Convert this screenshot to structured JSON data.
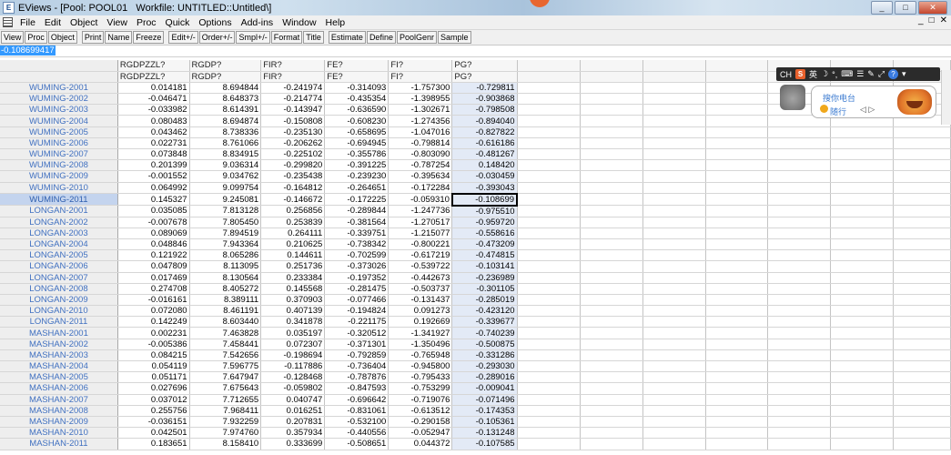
{
  "window": {
    "title": "EViews - [Pool: POOL01   Workfile: UNTITLED::Untitled\\]",
    "app_icon": "eviews-icon",
    "controls": [
      "_",
      "□",
      "✕"
    ]
  },
  "menu": {
    "items": [
      "File",
      "Edit",
      "Object",
      "View",
      "Proc",
      "Quick",
      "Options",
      "Add-ins",
      "Window",
      "Help"
    ],
    "doc_controls": [
      "_",
      "□",
      "✕"
    ]
  },
  "toolbar": {
    "groups": [
      [
        "View",
        "Proc",
        "Object"
      ],
      [
        "Print",
        "Name",
        "Freeze"
      ],
      [
        "Edit+/-",
        "Order+/-",
        "Smpl+/-",
        "Format",
        "Title"
      ],
      [
        "Estimate",
        "Define",
        "PoolGenr",
        "Sample"
      ]
    ]
  },
  "edit_line": {
    "value": "-0.108699417"
  },
  "grid": {
    "columns": [
      "RGDPZZL?",
      "RGDP?",
      "FIR?",
      "FE?",
      "FI?",
      "PG?"
    ],
    "subheaders": [
      "RGDPZZL?",
      "RGDP?",
      "FIR?",
      "FE?",
      "FI?",
      "PG?"
    ],
    "rows": [
      {
        "label": "WUMING-2001",
        "values": [
          "0.014181",
          "8.694844",
          "-0.241974",
          "-0.314093",
          "-1.757300",
          "-0.729811"
        ]
      },
      {
        "label": "WUMING-2002",
        "values": [
          "-0.046471",
          "8.648373",
          "-0.214774",
          "-0.435354",
          "-1.398955",
          "-0.903868"
        ]
      },
      {
        "label": "WUMING-2003",
        "values": [
          "-0.033982",
          "8.614391",
          "-0.143947",
          "-0.636590",
          "-1.302671",
          "-0.798508"
        ]
      },
      {
        "label": "WUMING-2004",
        "values": [
          "0.080483",
          "8.694874",
          "-0.150808",
          "-0.608230",
          "-1.274356",
          "-0.894040"
        ]
      },
      {
        "label": "WUMING-2005",
        "values": [
          "0.043462",
          "8.738336",
          "-0.235130",
          "-0.658695",
          "-1.047016",
          "-0.827822"
        ]
      },
      {
        "label": "WUMING-2006",
        "values": [
          "0.022731",
          "8.761066",
          "-0.206262",
          "-0.694945",
          "-0.798814",
          "-0.616186"
        ]
      },
      {
        "label": "WUMING-2007",
        "values": [
          "0.073848",
          "8.834915",
          "-0.225102",
          "-0.355786",
          "-0.803090",
          "-0.481267"
        ]
      },
      {
        "label": "WUMING-2008",
        "values": [
          "0.201399",
          "9.036314",
          "-0.299820",
          "-0.391225",
          "-0.787254",
          "0.148420"
        ]
      },
      {
        "label": "WUMING-2009",
        "values": [
          "-0.001552",
          "9.034762",
          "-0.235438",
          "-0.239230",
          "-0.395634",
          "-0.030459"
        ]
      },
      {
        "label": "WUMING-2010",
        "values": [
          "0.064992",
          "9.099754",
          "-0.164812",
          "-0.264651",
          "-0.172284",
          "-0.393043"
        ]
      },
      {
        "label": "WUMING-2011",
        "values": [
          "0.145327",
          "9.245081",
          "-0.146672",
          "-0.172225",
          "-0.059310",
          "-0.108699"
        ]
      },
      {
        "label": "LONGAN-2001",
        "values": [
          "0.035085",
          "7.813128",
          "0.256856",
          "-0.289844",
          "-1.247736",
          "-0.975510"
        ]
      },
      {
        "label": "LONGAN-2002",
        "values": [
          "-0.007678",
          "7.805450",
          "0.253839",
          "-0.381564",
          "-1.270517",
          "-0.959720"
        ]
      },
      {
        "label": "LONGAN-2003",
        "values": [
          "0.089069",
          "7.894519",
          "0.264111",
          "-0.339751",
          "-1.215077",
          "-0.558616"
        ]
      },
      {
        "label": "LONGAN-2004",
        "values": [
          "0.048846",
          "7.943364",
          "0.210625",
          "-0.738342",
          "-0.800221",
          "-0.473209"
        ]
      },
      {
        "label": "LONGAN-2005",
        "values": [
          "0.121922",
          "8.065286",
          "0.144611",
          "-0.702599",
          "-0.617219",
          "-0.474815"
        ]
      },
      {
        "label": "LONGAN-2006",
        "values": [
          "0.047809",
          "8.113095",
          "0.251736",
          "-0.373026",
          "-0.539722",
          "-0.103141"
        ]
      },
      {
        "label": "LONGAN-2007",
        "values": [
          "0.017469",
          "8.130564",
          "0.233384",
          "-0.197352",
          "-0.442673",
          "-0.236989"
        ]
      },
      {
        "label": "LONGAN-2008",
        "values": [
          "0.274708",
          "8.405272",
          "0.145568",
          "-0.281475",
          "-0.503737",
          "-0.301105"
        ]
      },
      {
        "label": "LONGAN-2009",
        "values": [
          "-0.016161",
          "8.389111",
          "0.370903",
          "-0.077466",
          "-0.131437",
          "-0.285019"
        ]
      },
      {
        "label": "LONGAN-2010",
        "values": [
          "0.072080",
          "8.461191",
          "0.407139",
          "-0.194824",
          "0.091273",
          "-0.423120"
        ]
      },
      {
        "label": "LONGAN-2011",
        "values": [
          "0.142249",
          "8.603440",
          "0.341878",
          "-0.221175",
          "0.192669",
          "-0.339677"
        ]
      },
      {
        "label": "MASHAN-2001",
        "values": [
          "0.002231",
          "7.463828",
          "0.035197",
          "-0.320512",
          "-1.341927",
          "-0.740239"
        ]
      },
      {
        "label": "MASHAN-2002",
        "values": [
          "-0.005386",
          "7.458441",
          "0.072307",
          "-0.371301",
          "-1.350496",
          "-0.500875"
        ]
      },
      {
        "label": "MASHAN-2003",
        "values": [
          "0.084215",
          "7.542656",
          "-0.198694",
          "-0.792859",
          "-0.765948",
          "-0.331286"
        ]
      },
      {
        "label": "MASHAN-2004",
        "values": [
          "0.054119",
          "7.596775",
          "-0.117886",
          "-0.736404",
          "-0.945800",
          "-0.293030"
        ]
      },
      {
        "label": "MASHAN-2005",
        "values": [
          "0.051171",
          "7.647947",
          "-0.128468",
          "-0.787876",
          "-0.795433",
          "-0.289016"
        ]
      },
      {
        "label": "MASHAN-2006",
        "values": [
          "0.027696",
          "7.675643",
          "-0.059802",
          "-0.847593",
          "-0.753299",
          "-0.009041"
        ]
      },
      {
        "label": "MASHAN-2007",
        "values": [
          "0.037012",
          "7.712655",
          "0.040747",
          "-0.696642",
          "-0.719076",
          "-0.071496"
        ]
      },
      {
        "label": "MASHAN-2008",
        "values": [
          "0.255756",
          "7.968411",
          "0.016251",
          "-0.831061",
          "-0.613512",
          "-0.174353"
        ]
      },
      {
        "label": "MASHAN-2009",
        "values": [
          "-0.036151",
          "7.932259",
          "0.207831",
          "-0.532100",
          "-0.290158",
          "-0.105361"
        ]
      },
      {
        "label": "MASHAN-2010",
        "values": [
          "0.042501",
          "7.974760",
          "0.357934",
          "-0.440556",
          "-0.052947",
          "-0.131248"
        ]
      },
      {
        "label": "MASHAN-2011",
        "values": [
          "0.183651",
          "8.158410",
          "0.333699",
          "-0.508651",
          "0.044372",
          "-0.107585"
        ]
      }
    ],
    "selected_row": 10,
    "active_column": 5
  },
  "ime_widget": {
    "bar_items": [
      "CH",
      "S",
      "英",
      "☽",
      "°,",
      "⌨",
      "☰",
      "✎",
      "⤢",
      "?",
      "▾"
    ],
    "line1": "搜你电台",
    "line2": "随行",
    "controls": "◁ ▷"
  },
  "colors": {
    "row_header_text": "#4070c0",
    "selection": "#3399ff",
    "ime_bar": "#2b2b2b"
  }
}
